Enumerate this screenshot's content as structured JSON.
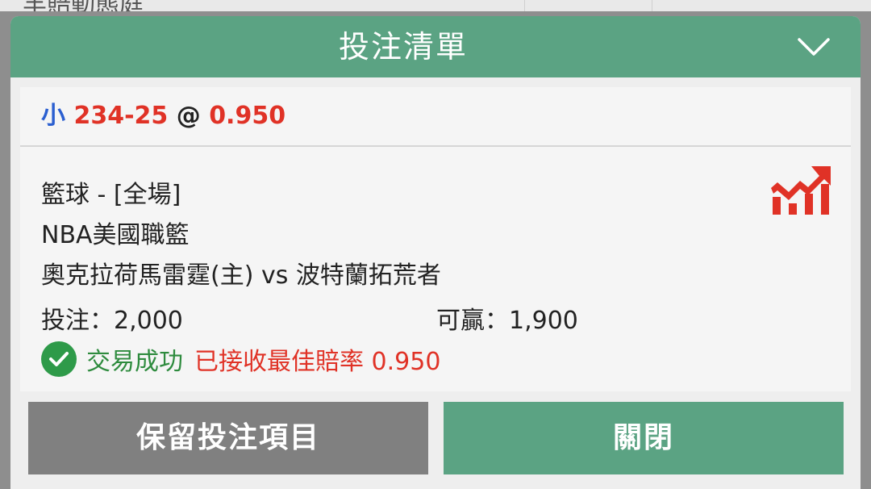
{
  "background": {
    "partial_text": "羊賠動態庭"
  },
  "header": {
    "title": "投注清單"
  },
  "selection": {
    "side": "小",
    "line": "234-25",
    "at": "@",
    "odds": "0.950"
  },
  "bet": {
    "market": "籃球 - [全場]",
    "league": "NBA美國職籃",
    "match": "奧克拉荷馬雷霆(主) vs 波特蘭拓荒者",
    "stake_label": "投注：",
    "stake_value": "2,000",
    "win_label": "可贏：",
    "win_value": "1,900"
  },
  "status": {
    "success": "交易成功",
    "note": "已接收最佳賠率 0.950"
  },
  "buttons": {
    "keep": "保留投注項目",
    "close": "關閉"
  },
  "colors": {
    "header_green": "#5ba383",
    "odds_red": "#e03226",
    "side_blue": "#2b5fd0",
    "success_green": "#2e9a49",
    "keep_gray": "#808080"
  },
  "icons": {
    "header_toggle": "chevron-down-icon",
    "stats": "stats-chart-icon",
    "status": "check-circle-icon"
  }
}
